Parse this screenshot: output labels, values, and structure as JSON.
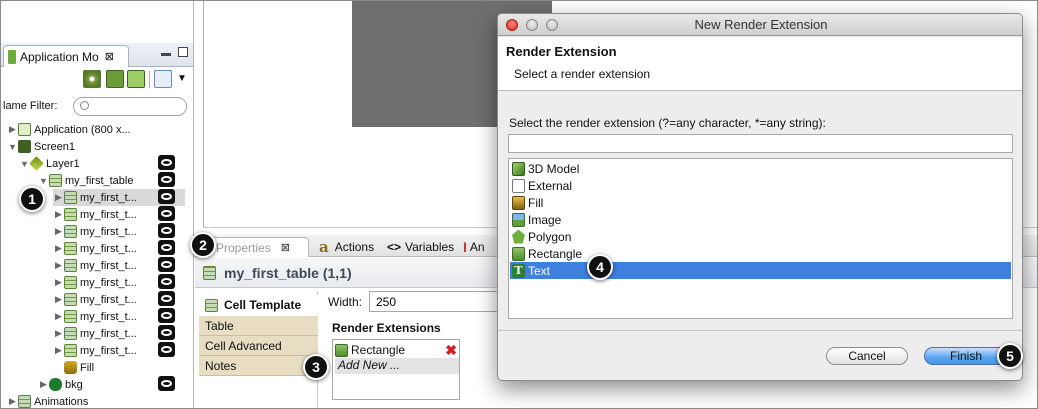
{
  "left_panel": {
    "tab_label": "Application Mo",
    "tab_close": "⊠",
    "filter_label": "lame Filter:",
    "filter_placeholder": "",
    "tree": [
      {
        "label": "Application (800 x...",
        "level": 0,
        "expanded": false,
        "icon": "application-icon"
      },
      {
        "label": "Screen1",
        "level": 0,
        "expanded": true,
        "icon": "screen-icon"
      },
      {
        "label": "Layer1",
        "level": 1,
        "expanded": true,
        "icon": "layer-icon"
      },
      {
        "label": "my_first_table",
        "level": 2,
        "expanded": true,
        "icon": "table-icon"
      },
      {
        "label": "my_first_t...",
        "level": 3,
        "expanded": false,
        "icon": "table-icon",
        "selected": true
      },
      {
        "label": "my_first_t...",
        "level": 3,
        "expanded": false,
        "icon": "table-icon"
      },
      {
        "label": "my_first_t...",
        "level": 3,
        "expanded": false,
        "icon": "table-icon"
      },
      {
        "label": "my_first_t...",
        "level": 3,
        "expanded": false,
        "icon": "table-icon"
      },
      {
        "label": "my_first_t...",
        "level": 3,
        "expanded": false,
        "icon": "table-icon"
      },
      {
        "label": "my_first_t...",
        "level": 3,
        "expanded": false,
        "icon": "table-icon"
      },
      {
        "label": "my_first_t...",
        "level": 3,
        "expanded": false,
        "icon": "table-icon"
      },
      {
        "label": "my_first_t...",
        "level": 3,
        "expanded": false,
        "icon": "table-icon"
      },
      {
        "label": "my_first_t...",
        "level": 3,
        "expanded": false,
        "icon": "table-icon"
      },
      {
        "label": "my_first_t...",
        "level": 3,
        "expanded": false,
        "icon": "table-icon"
      },
      {
        "label": "Fill",
        "level": 3,
        "expanded": false,
        "icon": "fill-icon"
      },
      {
        "label": "bkg",
        "level": 2,
        "expanded": false,
        "icon": "bkg-icon"
      },
      {
        "label": "Animations",
        "level": 0,
        "expanded": false,
        "icon": "animations-icon"
      }
    ]
  },
  "properties": {
    "tabs": [
      {
        "label": "Properties",
        "icon": "properties-icon"
      },
      {
        "label": "Actions",
        "icon": "actions-icon"
      },
      {
        "label": "Variables",
        "icon": "variables-icon"
      },
      {
        "label": "An",
        "icon": "animations-tab-icon"
      }
    ],
    "title": "my_first_table (1,1)",
    "side_tabs": [
      {
        "label": "Cell Template",
        "active": true
      },
      {
        "label": "Table"
      },
      {
        "label": "Cell Advanced"
      },
      {
        "label": "Notes"
      }
    ],
    "width_label": "Width:",
    "width_value": "250",
    "render_ext_label": "Render Extensions",
    "render_ext_items": [
      {
        "label": "Rectangle"
      }
    ],
    "add_new": "Add New ..."
  },
  "dialog": {
    "title": "New Render Extension",
    "banner_title": "Render Extension",
    "banner_subtitle": "Select a render extension",
    "select_label": "Select the render extension (?=any character, *=any string):",
    "filter_value": "",
    "extensions": [
      {
        "label": "3D Model",
        "icon": "3d-model-icon"
      },
      {
        "label": "External",
        "icon": "external-icon"
      },
      {
        "label": "Fill",
        "icon": "fill-icon"
      },
      {
        "label": "Image",
        "icon": "image-icon"
      },
      {
        "label": "Polygon",
        "icon": "polygon-icon"
      },
      {
        "label": "Rectangle",
        "icon": "rectangle-icon"
      },
      {
        "label": "Text",
        "icon": "text-icon",
        "selected": true
      }
    ],
    "cancel_label": "Cancel",
    "finish_label": "Finish"
  },
  "callouts": [
    "1",
    "2",
    "3",
    "4",
    "5"
  ]
}
